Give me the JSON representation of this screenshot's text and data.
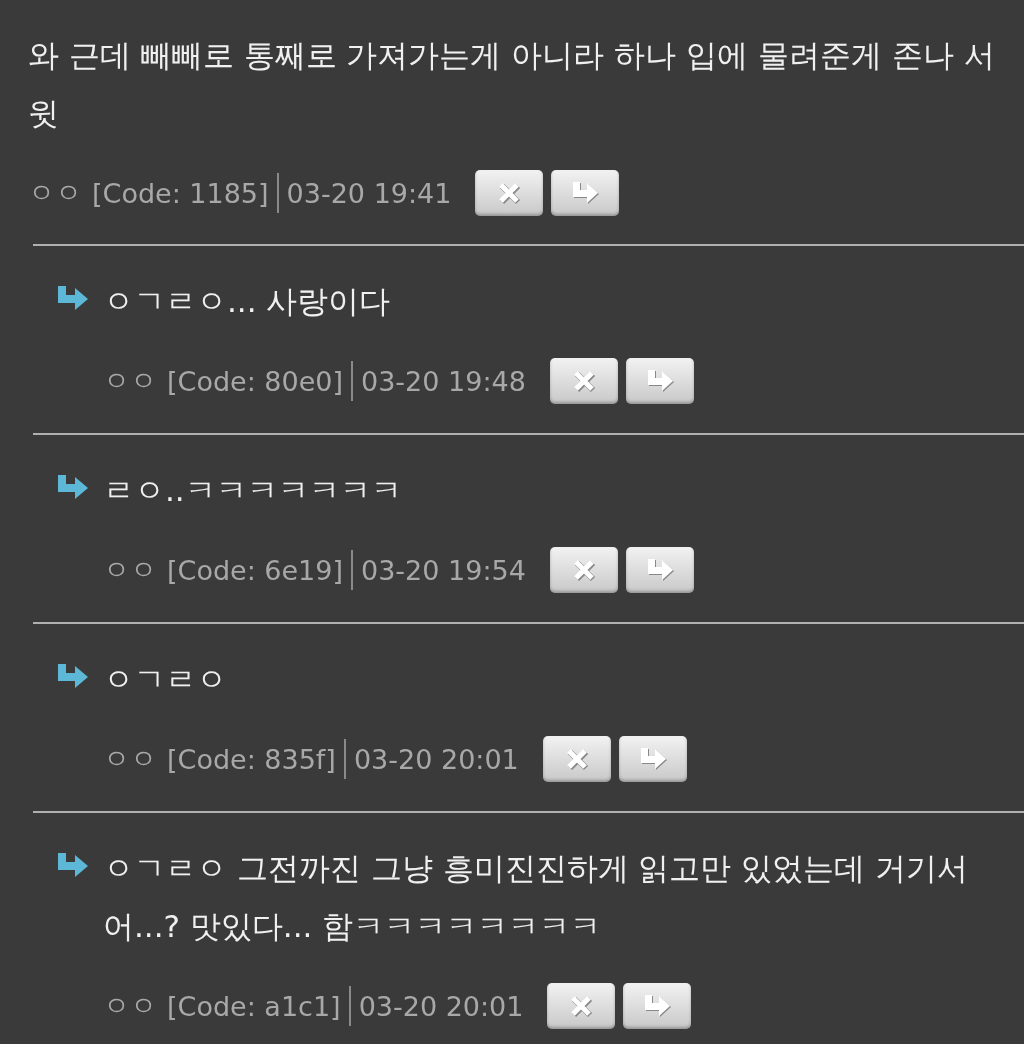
{
  "comments": [
    {
      "kind": "comment",
      "text": "와 근데 빼빼로 통째로 가져가는게 아니라 하나 입에 물려준게 존나 서윗",
      "author": "ㅇㅇ",
      "code": "[Code: 1185]",
      "time": "03-20 19:41"
    },
    {
      "kind": "reply",
      "text": "ㅇㄱㄹㅇ... 사랑이다",
      "author": "ㅇㅇ",
      "code": "[Code: 80e0]",
      "time": "03-20 19:48"
    },
    {
      "kind": "reply",
      "text": "ㄹㅇ..ㅋㅋㅋㅋㅋㅋㅋ",
      "author": "ㅇㅇ",
      "code": "[Code: 6e19]",
      "time": "03-20 19:54"
    },
    {
      "kind": "reply",
      "text": "ㅇㄱㄹㅇ",
      "author": "ㅇㅇ",
      "code": "[Code: 835f]",
      "time": "03-20 20:01"
    },
    {
      "kind": "reply",
      "text": "ㅇㄱㄹㅇ 그전까진 그냥 흥미진진하게 읽고만 있었는데 거기서 어...? 맛있다... 함ㅋㅋㅋㅋㅋㅋㅋㅋ",
      "author": "ㅇㅇ",
      "code": "[Code: a1c1]",
      "time": "03-20 20:01"
    }
  ]
}
